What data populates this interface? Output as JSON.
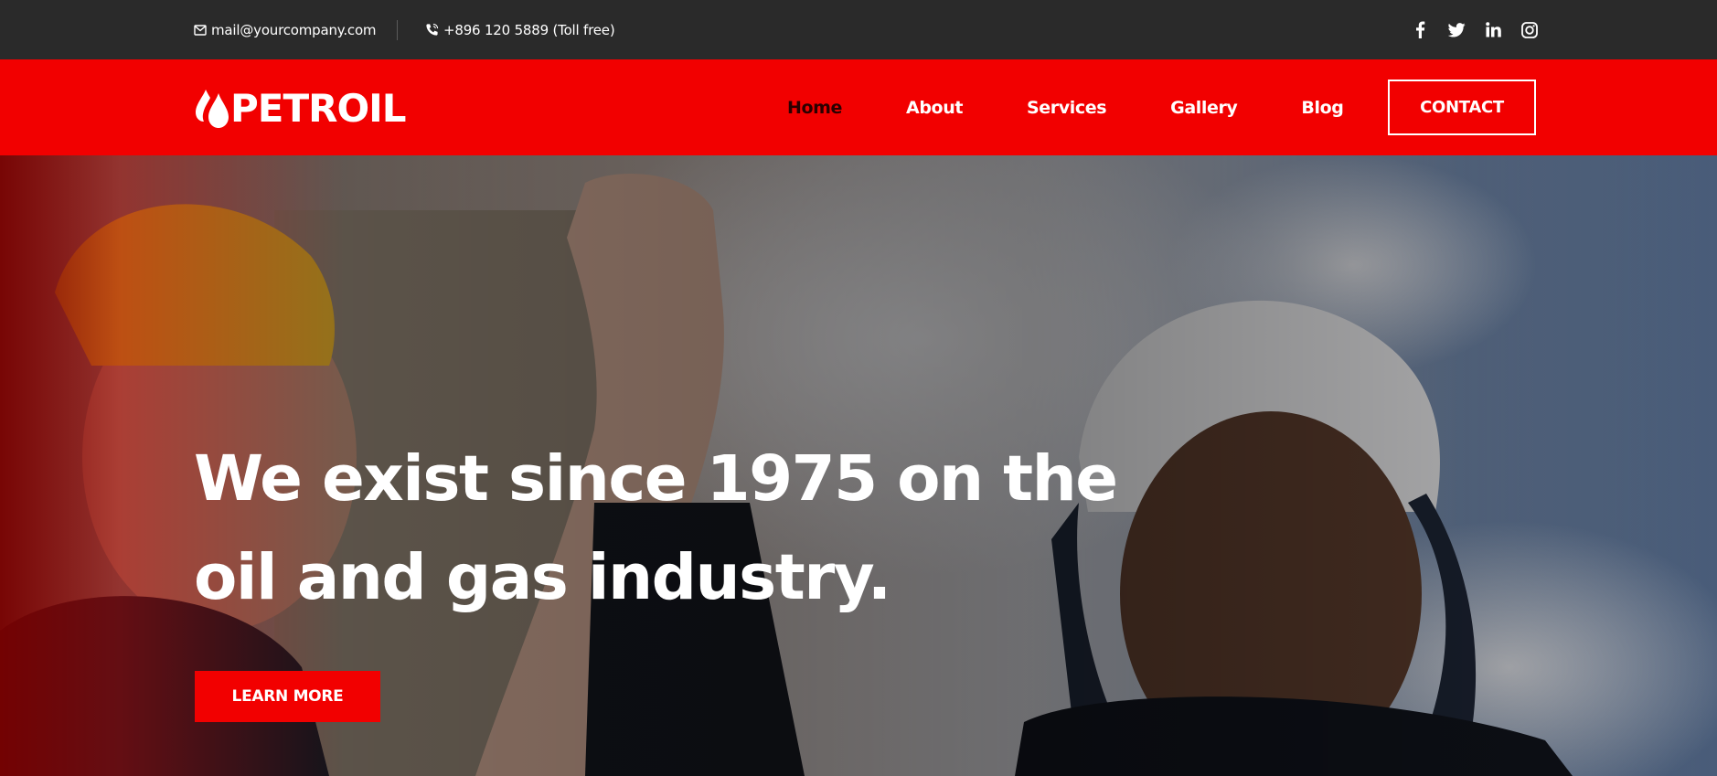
{
  "topbar": {
    "email": "mail@yourcompany.com",
    "email_icon": "envelope-icon",
    "phone": "+896 120 5889 (Toll free)",
    "phone_icon": "phone-icon",
    "socials": [
      "facebook-icon",
      "twitter-icon",
      "linkedin-icon",
      "instagram-icon"
    ]
  },
  "header": {
    "logo_text": "PETROIL",
    "nav": [
      {
        "label": "Home",
        "active": true
      },
      {
        "label": "About"
      },
      {
        "label": "Services"
      },
      {
        "label": "Gallery"
      },
      {
        "label": "Blog"
      }
    ],
    "contact_label": "CONTACT"
  },
  "hero": {
    "title": "We exist since 1975 on the oil and gas industry.",
    "button_label": "LEARN MORE"
  },
  "colors": {
    "brand_red": "#f20000",
    "topbar_bg": "#2a2a2a",
    "active_nav": "#2a0000"
  }
}
